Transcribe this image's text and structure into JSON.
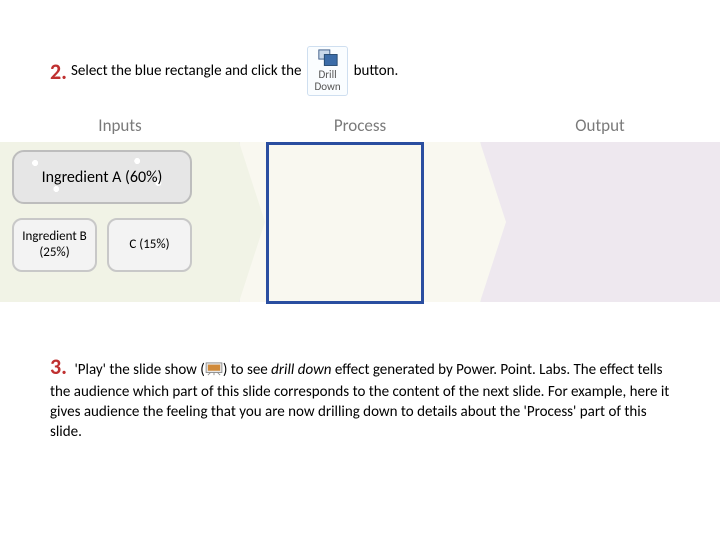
{
  "step2": {
    "num": "2.",
    "before": "Select the blue rectangle and click the",
    "after": "button.",
    "drill_label1": "Drill",
    "drill_label2": "Down"
  },
  "headers": {
    "inputs": "Inputs",
    "process": "Process",
    "output": "Output"
  },
  "ingredients": {
    "a": "Ingredient A (60%)",
    "b": "Ingredient B (25%)",
    "c": "C (15%)"
  },
  "step3": {
    "num": "3.",
    "before": "'Play' the slide show (",
    "mid": ") to see ",
    "dd": "drill down",
    "after": " effect generated by Power. Point. Labs. The effect tells the audience which part of this slide corresponds to the content of the next slide. For example, here it gives audience the feeling that you are now drilling down to details about the 'Process' part of this slide."
  }
}
